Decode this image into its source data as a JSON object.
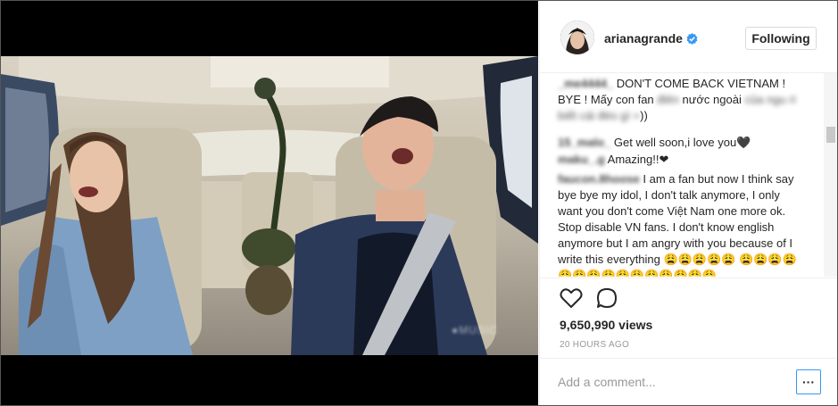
{
  "post": {
    "username": "arianagrande",
    "follow_label": "Following",
    "views": "9,650,990 views",
    "time_ago": "20 HOURS AGO",
    "comment_placeholder": "Add a comment...",
    "more_label": "···"
  },
  "video": {
    "watermark": "●MUSIC"
  },
  "comments": [
    {
      "user": "_me4444_",
      "parts": [
        {
          "text": " DON'T COME BACK VIETNAM ! BYE ! Mấy con fan "
        },
        {
          "text": "điên",
          "blur": true
        },
        {
          "text": " nước ngoài "
        },
        {
          "text": "của ngu rì biết cái đéo gì =",
          "blur": true
        },
        {
          "text": "))"
        }
      ]
    },
    {
      "user": "15_malo_",
      "parts": [
        {
          "text": " Get well soon,i love you🖤"
        }
      ]
    },
    {
      "user": "maku_.g",
      "parts": [
        {
          "text": " Amazing!!❤"
        }
      ]
    },
    {
      "user": "faucon.8hoose",
      "parts": [
        {
          "text": " I am a fan but now I think say bye bye my idol, I don't talk anymore, I only want you don't come Việt Nam one more ok. Stop disable VN fans. I don't know english anymore but I am angry with you because of I write this everything 😩😩😩😩😩 😩😩😩😩😩😩😩😩😩😩😩😩😩😩😩"
        }
      ]
    }
  ],
  "icons": {
    "like": "heart-icon",
    "comment": "comment-bubble-icon",
    "verified": "verified-badge-icon"
  },
  "colors": {
    "link_blue": "#3897f0",
    "text": "#262626",
    "muted": "#999999"
  }
}
